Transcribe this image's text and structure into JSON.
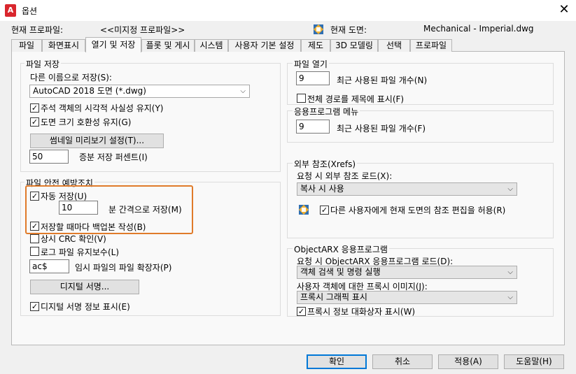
{
  "window": {
    "title": "옵션",
    "close_glyph": "✕",
    "app_letter": "A"
  },
  "header": {
    "profile_label": "현재 프로파일:",
    "profile_value": "<<미지정 프로파일>>",
    "drawing_label": "현재 도면:",
    "drawing_value": "Mechanical - Imperial.dwg"
  },
  "tabs": [
    "파일",
    "화면표시",
    "열기 및 저장",
    "플롯 및 게시",
    "시스템",
    "사용자 기본 설정",
    "제도",
    "3D 모델링",
    "선택",
    "프로파일"
  ],
  "active_tab": "열기 및 저장",
  "file_save": {
    "title": "파일 저장",
    "saveas_label": "다른 이름으로 저장(S):",
    "saveas_value": "AutoCAD 2018 도면 (*.dwg)",
    "cb_annotative": {
      "label": "주석 객체의 시각적 사실성 유지(Y)",
      "checked": true
    },
    "cb_drawing_size": {
      "label": "도면 크기 호환성 유지(G)",
      "checked": true
    },
    "thumbnail_button": "썸네일 미리보기 설정(T)...",
    "incremental_value": "50",
    "incremental_label": "증분 저장 퍼센트(I)"
  },
  "file_safety": {
    "title": "파일 안전 예방조치",
    "autosave": {
      "label": "자동 저장(U)",
      "checked": true
    },
    "minutes_value": "10",
    "minutes_label": "분 간격으로 저장(M)",
    "backup": {
      "label": "저장할 때마다 백업본 작성(B)",
      "checked": true
    },
    "crc": {
      "label": "상시 CRC 확인(V)",
      "checked": false
    },
    "log": {
      "label": "로그 파일 유지보수(L)",
      "checked": false
    },
    "temp_ext_value": "ac$",
    "temp_ext_label": "임시 파일의 파일 확장자(P)",
    "digital_sig_button": "디지털 서명...",
    "digital_sig_info": {
      "label": "디지털 서명 정보 표시(E)",
      "checked": true
    }
  },
  "file_open": {
    "title": "파일 열기",
    "recent_value": "9",
    "recent_label": "최근 사용된 파일 개수(N)",
    "fullpath": {
      "label": "전체 경로를 제목에 표시(F)",
      "checked": false
    }
  },
  "app_menu": {
    "title": "응용프로그램 메뉴",
    "recent_value": "9",
    "recent_label": "최근 사용된 파일 개수(F)"
  },
  "xrefs": {
    "title": "외부 참조(Xrefs)",
    "demand_label": "요청 시 외부 참조 로드(X):",
    "demand_value": "복사 시 사용",
    "allow_edit": {
      "label": "다른 사용자에게 현재 도면의 참조 편집을 허용(R)",
      "checked": true
    }
  },
  "objectarx": {
    "title": "ObjectARX 응용프로그램",
    "load_label": "요청 시 ObjectARX 응용프로그램 로드(D):",
    "load_value": "객체 검색 및 명령 실행",
    "proxy_label": "사용자 객체에 대한 프록시 이미지(J):",
    "proxy_value": "프록시 그래픽 표시",
    "proxy_dialog": {
      "label": "프록시 정보 대화상자 표시(W)",
      "checked": true
    }
  },
  "buttons": {
    "ok": "확인",
    "cancel": "취소",
    "apply": "적용(A)",
    "help": "도움말(H)"
  },
  "colors": {
    "highlight": "#e07b2a",
    "default_button": "#0078d7",
    "app_icon": "#d9262d"
  }
}
